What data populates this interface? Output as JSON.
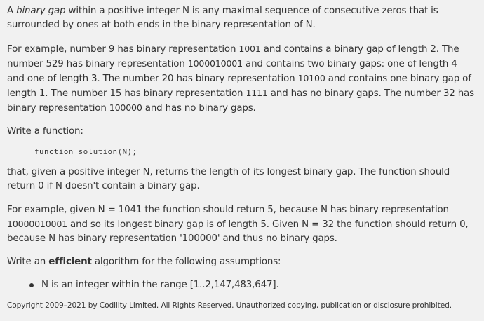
{
  "intro": {
    "article": "A ",
    "term": "binary gap",
    "rest": " within a positive integer N is any maximal sequence of consecutive zeros that is surrounded by ones at both ends in the binary representation of N."
  },
  "examples": {
    "t1": "For example, number 9 has binary representation ",
    "b1": "1001",
    "t2": " and contains a binary gap of length 2. The number 529 has binary representation ",
    "b2": "1000010001",
    "t3": " and contains two binary gaps: one of length 4 and one of length 3. The number 20 has binary representation ",
    "b3": "10100",
    "t4": " and contains one binary gap of length 1. The number 15 has binary representation ",
    "b4": "1111",
    "t5": " and has no binary gaps. The number 32 has binary representation ",
    "b5": "100000",
    "t6": " and has no binary gaps."
  },
  "write_function": "Write a function:",
  "code_signature": "function solution(N);",
  "description": "that, given a positive integer N, returns the length of its longest binary gap. The function should return 0 if N doesn't contain a binary gap.",
  "example2": {
    "t1": "For example, given N = 1041 the function should return 5, because N has binary representation ",
    "b1": "10000010001",
    "t2": " and so its longest binary gap is of length 5. Given N = 32 the function should return 0, because N has binary representation '100000' and thus no binary gaps."
  },
  "efficient": {
    "before": "Write an ",
    "bold": "efficient",
    "after": " algorithm for the following assumptions:"
  },
  "assumptions": [
    "N is an integer within the range [1..2,147,483,647]."
  ],
  "copyright": "Copyright 2009–2021 by Codility Limited. All Rights Reserved. Unauthorized copying, publication or disclosure prohibited."
}
